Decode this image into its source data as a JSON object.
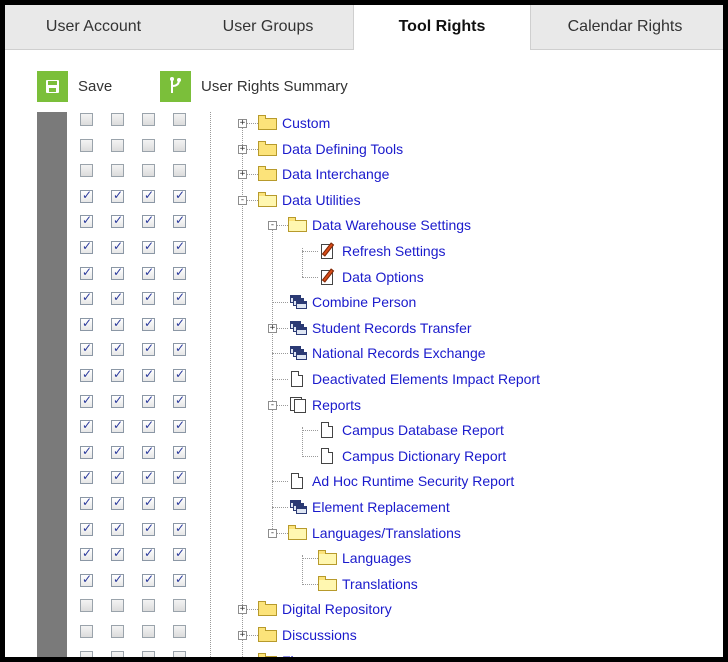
{
  "tabs": [
    {
      "label": "User Account"
    },
    {
      "label": "User Groups"
    },
    {
      "label": "Tool Rights"
    },
    {
      "label": "Calendar Rights"
    }
  ],
  "toolbar": {
    "save_label": "Save",
    "summary_label": "User Rights Summary"
  },
  "colors": {
    "accent_green": "#7bbf3a",
    "link_blue": "#1a1acc",
    "left_bar": "#7a7a7a"
  },
  "rows": [
    {
      "checked": [
        false,
        false,
        false,
        false
      ]
    },
    {
      "checked": [
        false,
        false,
        false,
        false
      ]
    },
    {
      "checked": [
        false,
        false,
        false,
        false
      ]
    },
    {
      "checked": [
        true,
        true,
        true,
        true
      ]
    },
    {
      "checked": [
        true,
        true,
        true,
        true
      ]
    },
    {
      "checked": [
        true,
        true,
        true,
        true
      ]
    },
    {
      "checked": [
        true,
        true,
        true,
        true
      ]
    },
    {
      "checked": [
        true,
        true,
        true,
        true
      ]
    },
    {
      "checked": [
        true,
        true,
        true,
        true
      ]
    },
    {
      "checked": [
        true,
        true,
        true,
        true
      ]
    },
    {
      "checked": [
        true,
        true,
        true,
        true
      ]
    },
    {
      "checked": [
        true,
        true,
        true,
        true
      ]
    },
    {
      "checked": [
        true,
        true,
        true,
        true
      ]
    },
    {
      "checked": [
        true,
        true,
        true,
        true
      ]
    },
    {
      "checked": [
        true,
        true,
        true,
        true
      ]
    },
    {
      "checked": [
        true,
        true,
        true,
        true
      ]
    },
    {
      "checked": [
        true,
        true,
        true,
        true
      ]
    },
    {
      "checked": [
        true,
        true,
        true,
        true
      ]
    },
    {
      "checked": [
        true,
        true,
        true,
        true
      ]
    },
    {
      "checked": [
        false,
        false,
        false,
        false
      ]
    },
    {
      "checked": [
        false,
        false,
        false,
        false
      ]
    },
    {
      "checked": [
        false,
        false,
        false,
        false
      ]
    }
  ],
  "tree": [
    {
      "label": "Custom",
      "icon": "folder-icon",
      "expander": "+"
    },
    {
      "label": "Data Defining Tools",
      "icon": "folder-icon",
      "expander": "+"
    },
    {
      "label": "Data Interchange",
      "icon": "folder-icon",
      "expander": "+"
    },
    {
      "label": "Data Utilities",
      "icon": "folder-open-icon",
      "expander": "-"
    },
    {
      "label": "Data Warehouse Settings",
      "icon": "folder-open-icon",
      "expander": "-"
    },
    {
      "label": "Refresh Settings",
      "icon": "edit-document-icon",
      "expander": ""
    },
    {
      "label": "Data Options",
      "icon": "edit-document-icon",
      "expander": ""
    },
    {
      "label": "Combine Person",
      "icon": "multi-window-icon",
      "expander": ""
    },
    {
      "label": "Student Records Transfer",
      "icon": "multi-window-icon",
      "expander": "+"
    },
    {
      "label": "National Records Exchange",
      "icon": "multi-window-icon",
      "expander": ""
    },
    {
      "label": "Deactivated Elements Impact Report",
      "icon": "document-icon",
      "expander": ""
    },
    {
      "label": "Reports",
      "icon": "document-stack-icon",
      "expander": "-"
    },
    {
      "label": "Campus Database Report",
      "icon": "document-icon",
      "expander": ""
    },
    {
      "label": "Campus Dictionary Report",
      "icon": "document-icon",
      "expander": ""
    },
    {
      "label": "Ad Hoc Runtime Security Report",
      "icon": "document-icon",
      "expander": ""
    },
    {
      "label": "Element Replacement",
      "icon": "multi-window-icon",
      "expander": ""
    },
    {
      "label": "Languages/Translations",
      "icon": "folder-open-icon",
      "expander": "-"
    },
    {
      "label": "Languages",
      "icon": "folder-open-icon",
      "expander": ""
    },
    {
      "label": "Translations",
      "icon": "folder-open-icon",
      "expander": ""
    },
    {
      "label": "Digital Repository",
      "icon": "folder-icon",
      "expander": "+"
    },
    {
      "label": "Discussions",
      "icon": "folder-icon",
      "expander": "+"
    },
    {
      "label": "Finance",
      "icon": "folder-icon",
      "expander": "+"
    }
  ]
}
